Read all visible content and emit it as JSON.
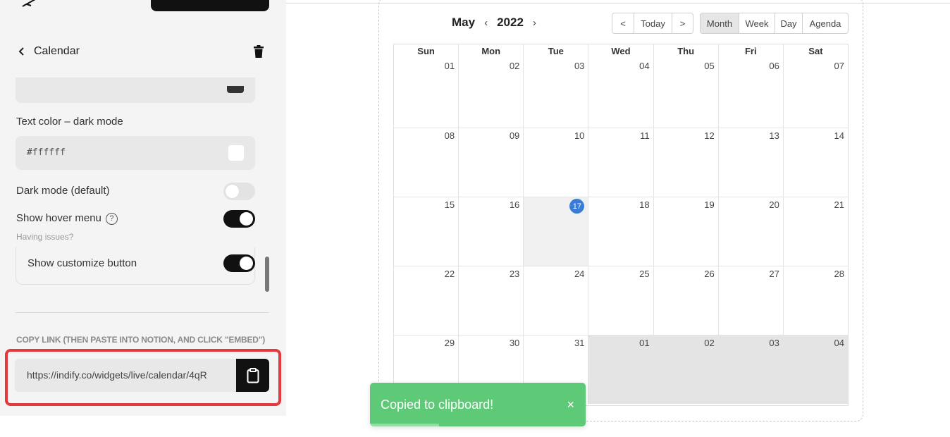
{
  "panel": {
    "title": "Calendar",
    "text_color_dark_label": "Text color – dark mode",
    "text_color_dark_value": "#ffffff",
    "dark_mode_label": "Dark mode (default)",
    "dark_mode_on": false,
    "hover_menu_label": "Show hover menu",
    "hover_menu_on": true,
    "having_issues": "Having issues?",
    "customize_label": "Show customize button",
    "customize_on": true,
    "copy_link_heading": "COPY LINK (THEN PASTE INTO NOTION, AND CLICK \"EMBED\")",
    "link_value": "https://indify.co/widgets/live/calendar/4qR",
    "help_icon_glyph": "?"
  },
  "calendar": {
    "month": "May",
    "year": "2022",
    "prev_glyph": "‹",
    "next_glyph": "›",
    "nav_prev": "<",
    "today_label": "Today",
    "nav_next": ">",
    "views": [
      "Month",
      "Week",
      "Day",
      "Agenda"
    ],
    "active_view": "Month",
    "weekdays": [
      "Sun",
      "Mon",
      "Tue",
      "Wed",
      "Thu",
      "Fri",
      "Sat"
    ],
    "weeks": [
      [
        {
          "d": "01"
        },
        {
          "d": "02"
        },
        {
          "d": "03"
        },
        {
          "d": "04"
        },
        {
          "d": "05"
        },
        {
          "d": "06"
        },
        {
          "d": "07"
        }
      ],
      [
        {
          "d": "08"
        },
        {
          "d": "09"
        },
        {
          "d": "10"
        },
        {
          "d": "11"
        },
        {
          "d": "12"
        },
        {
          "d": "13"
        },
        {
          "d": "14"
        }
      ],
      [
        {
          "d": "15"
        },
        {
          "d": "16"
        },
        {
          "d": "17",
          "today": true
        },
        {
          "d": "18"
        },
        {
          "d": "19"
        },
        {
          "d": "20"
        },
        {
          "d": "21"
        }
      ],
      [
        {
          "d": "22"
        },
        {
          "d": "23"
        },
        {
          "d": "24"
        },
        {
          "d": "25"
        },
        {
          "d": "26"
        },
        {
          "d": "27"
        },
        {
          "d": "28"
        }
      ],
      [
        {
          "d": "29"
        },
        {
          "d": "30"
        },
        {
          "d": "31"
        },
        {
          "d": "01",
          "off": true
        },
        {
          "d": "02",
          "off": true
        },
        {
          "d": "03",
          "off": true
        },
        {
          "d": "04",
          "off": true
        }
      ]
    ]
  },
  "toast": {
    "message": "Copied to clipboard!",
    "close_glyph": "×",
    "progress": 0.32
  },
  "colors": {
    "highlight": "#e5373e",
    "toast": "#5ec977",
    "today_badge": "#3a7bd5"
  }
}
